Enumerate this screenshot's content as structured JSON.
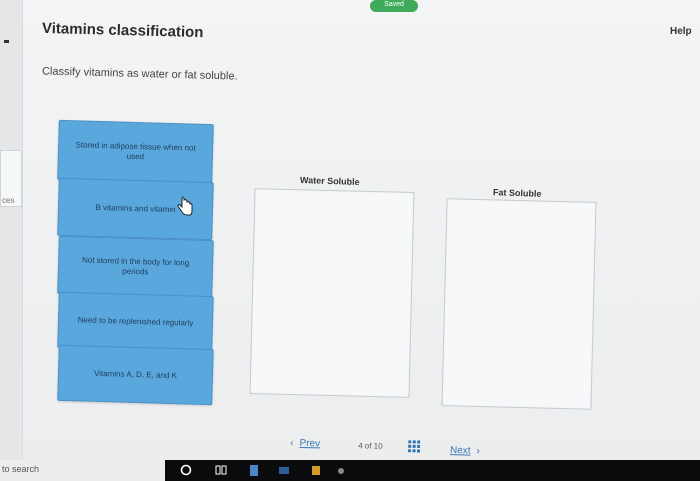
{
  "header": {
    "saved_badge": "Saved",
    "help_label": "Help"
  },
  "title": "Vitamins classification",
  "instructions": "Classify vitamins as water or fat soluble.",
  "left_strip": {
    "partial_text": "ces"
  },
  "cards": [
    "Stored in adipose tissue when not used",
    "B vitamins and vitamin",
    "Not stored in the body for long periods",
    "Need to be replenished regularly",
    "Vitamins A, D, E, and K"
  ],
  "zones": {
    "water_label": "Water Soluble",
    "fat_label": "Fat Soluble"
  },
  "pager": {
    "prev_label": "Prev",
    "page_text": "4 of 10",
    "next_label": "Next"
  },
  "taskbar": {
    "search_text": "to search"
  },
  "colors": {
    "card_bg": "#5aa7de",
    "link": "#3a78b5",
    "saved_badge": "#3eaa5a",
    "taskbar": "#0b0b0d"
  }
}
